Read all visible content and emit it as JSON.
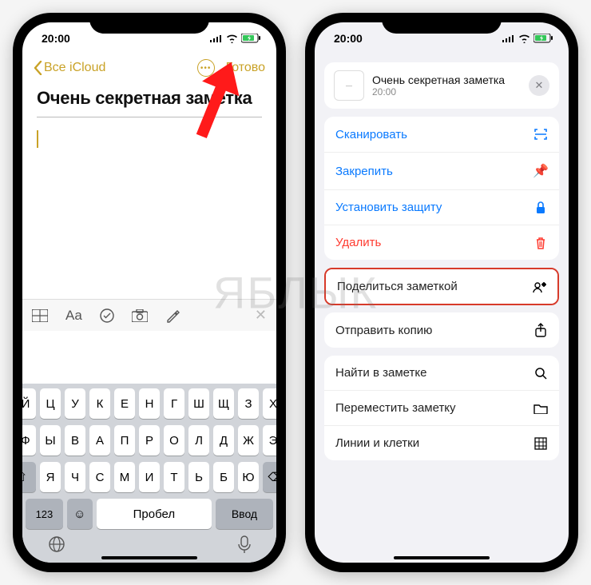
{
  "watermark": "ЯБЛЫК",
  "status": {
    "time": "20:00"
  },
  "phone1": {
    "back_label": "Все iCloud",
    "done_label": "Готово",
    "note_title": "Очень секретная заметка",
    "keyboard": {
      "row1": [
        "Й",
        "Ц",
        "У",
        "К",
        "Е",
        "Н",
        "Г",
        "Ш",
        "Щ",
        "З",
        "Х"
      ],
      "row2": [
        "Ф",
        "Ы",
        "В",
        "А",
        "П",
        "Р",
        "О",
        "Л",
        "Д",
        "Ж",
        "Э"
      ],
      "row3_shift": "⇧",
      "row3": [
        "Я",
        "Ч",
        "С",
        "М",
        "И",
        "Т",
        "Ь",
        "Б",
        "Ю"
      ],
      "row3_del": "⌫",
      "num_key": "123",
      "space": "Пробел",
      "enter": "Ввод"
    }
  },
  "phone2": {
    "header_title": "Очень секретная заметка",
    "header_subtitle": "20:00",
    "group1": {
      "scan": "Сканировать",
      "pin": "Закрепить",
      "lock": "Установить защиту",
      "delete": "Удалить"
    },
    "group2": {
      "share": "Поделиться заметкой",
      "send_copy": "Отправить копию"
    },
    "group3": {
      "find": "Найти в заметке",
      "move": "Переместить заметку",
      "lines": "Линии и клетки"
    }
  }
}
